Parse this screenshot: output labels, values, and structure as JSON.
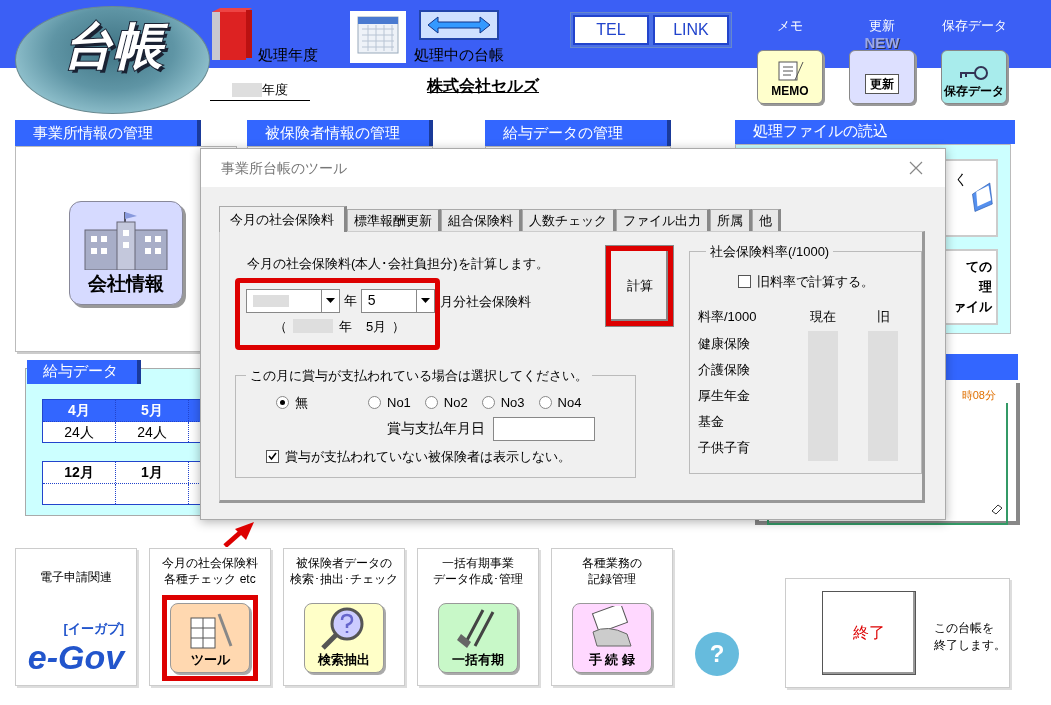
{
  "header": {
    "logo": "台帳",
    "fiscal_year_label": "処理年度",
    "fiscal_year_suffix": "年度",
    "ledger_label": "処理中の台帳",
    "company": "株式会社セルズ",
    "links": [
      "TEL",
      "LINK"
    ],
    "tools": [
      {
        "kind": "memo",
        "label": "メモ",
        "badge": "MEMO"
      },
      {
        "kind": "update",
        "label": "更新",
        "badge": "更新",
        "corner": "NEW"
      },
      {
        "kind": "save",
        "label": "保存データ",
        "badge": "保存データ"
      }
    ]
  },
  "office": {
    "title": "事業所情報の管理",
    "button": "会社情報"
  },
  "covered_panels": [
    "被保険者情報の管理",
    "給与データの管理"
  ],
  "files": {
    "title": "処理ファイルの読込",
    "button_1": "く",
    "button_2": [
      "ての",
      "理",
      "ァイル"
    ]
  },
  "clock": {
    "time": "時08分"
  },
  "salary": {
    "title": "給与データ",
    "blocks": [
      {
        "months": [
          "4月",
          "5月"
        ],
        "counts": [
          "24人",
          "24人"
        ],
        "header_filled": true
      },
      {
        "months": [
          "12月",
          "1月"
        ],
        "header_filled": false
      }
    ]
  },
  "dialog": {
    "title": "事業所台帳のツール",
    "tabs": [
      {
        "label": "今月の社会保険料",
        "selected": true
      },
      {
        "label": "標準報酬更新",
        "selected": false
      },
      {
        "label": "組合保険料",
        "selected": false
      },
      {
        "label": "人数チェック",
        "selected": false
      },
      {
        "label": "ファイル出力",
        "selected": false
      },
      {
        "label": "所属",
        "selected": false
      },
      {
        "label": "他",
        "selected": false
      }
    ],
    "intro": "今月の社会保険料(本人･会社負担分)を計算します。",
    "year_unit": "年",
    "month_value": "5",
    "month_suffix": "月分社会保険料",
    "period_open": "（",
    "period_year_unit": "年",
    "period_month": "5月",
    "period_close": "）",
    "inputs_highlighted": true,
    "calc_button": "計算",
    "calc_highlighted": true,
    "bonus": {
      "legend": "この月に賞与が支払われている場合は選択してください。",
      "options": [
        {
          "label": "無",
          "selected": true
        },
        {
          "label": "No1",
          "selected": false
        },
        {
          "label": "No2",
          "selected": false
        },
        {
          "label": "No3",
          "selected": false
        },
        {
          "label": "No4",
          "selected": false
        }
      ],
      "date_label": "賞与支払年月日",
      "hide_unpaid": {
        "label": "賞与が支払われていない被保険者は表示しない。",
        "checked": true
      }
    },
    "rates": {
      "legend": "社会保険料率(/1000)",
      "use_old": {
        "label": "旧料率で計算する。",
        "checked": false
      },
      "columns": [
        "料率/1000",
        "現在",
        "旧"
      ],
      "rows": [
        "健康保険",
        "介護保険",
        "厚生年金",
        "基金",
        "子供子育"
      ]
    }
  },
  "tiles": [
    {
      "kind": "egov",
      "caption": [
        "電子申請関連"
      ],
      "badge": "e-Gov",
      "sub": "[イーガブ]",
      "highlighted": false
    },
    {
      "kind": "tools",
      "caption": [
        "今月の社会保険料",
        "各種チェック etc"
      ],
      "badge": "ツール",
      "highlighted": true
    },
    {
      "kind": "search",
      "caption": [
        "被保険者データの",
        "検索･抽出･チェック"
      ],
      "badge": "検索抽出",
      "highlighted": false
    },
    {
      "kind": "shovel",
      "caption": [
        "一括有期事業",
        "データ作成･管理"
      ],
      "badge": "一括有期",
      "highlighted": false
    },
    {
      "kind": "record",
      "caption": [
        "各種業務の",
        "記録管理"
      ],
      "badge": "手 続 録",
      "highlighted": false
    }
  ],
  "help": "?",
  "exit": {
    "button": "終了",
    "note": [
      "この台帳を",
      "終了します。"
    ]
  }
}
